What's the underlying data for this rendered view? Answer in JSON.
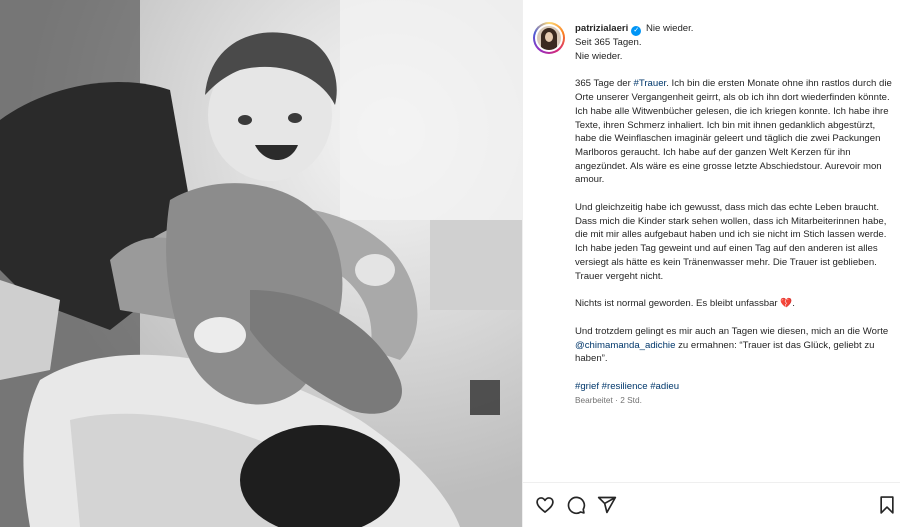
{
  "post": {
    "username": "patrizialaeri",
    "verified_mark": "✓",
    "header_lines": [
      "Nie wieder.",
      "Seit 365 Tagen.",
      "Nie wieder."
    ],
    "paragraph1": {
      "prefix": "365 Tage der ",
      "hashtag": "#Trauer",
      "text": ". Ich bin die ersten Monate ohne ihn rastlos durch die Orte unserer Vergangenheit geirrt, als ob ich ihn dort wiederfinden könnte. Ich habe alle Witwenbücher gelesen, die ich kriegen konnte. Ich habe ihre Texte, ihren Schmerz inhaliert. Ich bin mit ihnen gedanklich abgestürzt, habe die Weinflaschen imaginär geleert und täglich die zwei Packungen Marlboros geraucht. Ich habe auf der ganzen Welt Kerzen für ihn angezündet. Als wäre es eine grosse letzte Abschiedstour. Aurevoir mon amour."
    },
    "paragraph2": "Und gleichzeitig habe ich gewusst, dass mich das echte Leben braucht. Dass mich die Kinder stark sehen wollen, dass ich Mitarbeiterinnen habe, die mit mir alles aufgebaut haben und ich sie nicht im Stich lassen werde. Ich habe jeden Tag geweint und auf einen Tag auf den anderen ist alles versiegt als hätte es kein Tränenwasser mehr. Die Trauer ist geblieben. Trauer vergeht nicht.",
    "paragraph3": {
      "text": "Nichts ist normal geworden. Es bleibt unfassbar ",
      "emoji": "💔",
      "suffix": "."
    },
    "paragraph4": {
      "prefix": "Und trotzdem gelingt es mir auch an Tagen wie diesen, mich an die Worte ",
      "mention": "@chimamanda_adichie",
      "suffix": " zu ermahnen: “Trauer ist das Glück, geliebt zu haben”."
    },
    "hashtags": [
      "#grief",
      "#resilience",
      "#adieu"
    ],
    "meta": "Bearbeitet · 2 Std."
  },
  "actions": {
    "icons": [
      "heart-icon",
      "comment-icon",
      "share-icon",
      "bookmark-icon"
    ]
  },
  "colors": {
    "link": "#00376b",
    "verified": "#0095f6",
    "meta": "#737373",
    "broken_heart": "#e0245e"
  }
}
